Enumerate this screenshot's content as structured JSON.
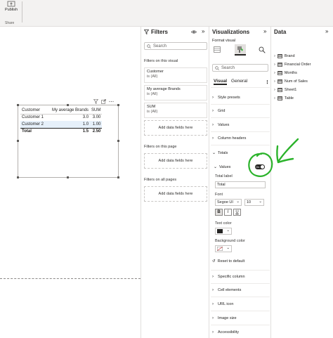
{
  "ribbon": {
    "publish_label": "Publish",
    "group_label": "Share"
  },
  "canvas": {
    "matrix": {
      "headers": [
        "Customer",
        "My average Brands",
        "SUM"
      ],
      "rows": [
        [
          "Customer 1",
          "3.0",
          "3.00"
        ],
        [
          "Customer 2",
          "1.0",
          "1.00"
        ]
      ],
      "total": [
        "Total",
        "1.5",
        "2.50"
      ]
    }
  },
  "filters": {
    "title": "Filters",
    "search_placeholder": "Search",
    "on_visual_label": "Filters on this visual",
    "cards": [
      {
        "name": "Customer",
        "state": "is (All)"
      },
      {
        "name": "My average Brands",
        "state": "is (All)"
      },
      {
        "name": "SUM",
        "state": "is (All)"
      }
    ],
    "add_fields_label": "Add data fields here",
    "on_page_label": "Filters on this page",
    "all_pages_label": "Filters on all pages"
  },
  "visualizations": {
    "title": "Visualizations",
    "format_visual_label": "Format visual",
    "search_placeholder": "Search",
    "tabs": [
      "Visual",
      "General"
    ],
    "sections_top": [
      "Style presets",
      "Grid",
      "Values",
      "Column headers"
    ],
    "totals_section": "Totals",
    "values_subsection": "Values",
    "toggle_label": "On",
    "total_label_caption": "Total label",
    "total_label_value": "Total",
    "font_caption": "Font",
    "font_family": "Segoe UI",
    "font_size": "10",
    "format_buttons": [
      "B",
      "I",
      "U"
    ],
    "text_color_caption": "Text color",
    "background_color_caption": "Background color",
    "reset_label": "Reset to default",
    "sections_bottom": [
      "Specific column",
      "Cell elements",
      "URL icon",
      "Image size",
      "Accessibility"
    ]
  },
  "data": {
    "title": "Data",
    "tables": [
      "Brand",
      "Financial Order",
      "Months",
      "Num of Sales",
      "Sheet1",
      "Table"
    ]
  },
  "colors": {
    "annotation": "#2bb32b",
    "selection": "#e6f0fa",
    "text_color_swatch": "#252423"
  }
}
